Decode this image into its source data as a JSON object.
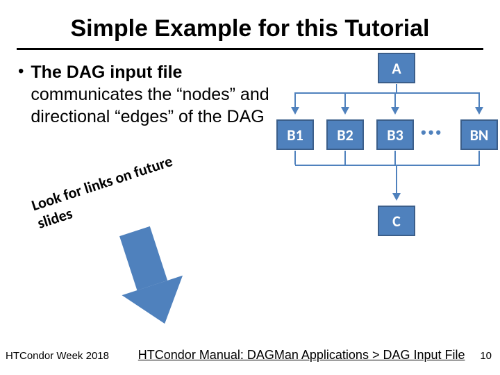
{
  "title": "Simple Example for this Tutorial",
  "bullet": {
    "preBold": "The DAG input file",
    "rest": " communicates the “nodes” and directional “edges” of the DAG"
  },
  "annotation": "Look for links on future slides",
  "dag": {
    "A": "A",
    "B1": "B1",
    "B2": "B2",
    "B3": "B3",
    "dots": "•••",
    "BN": "BN",
    "C": "C"
  },
  "footer": {
    "event": "HTCondor Week 2018",
    "link_text": "HTCondor Manual: DAGMan Applications > DAG Input File",
    "page": "10"
  }
}
